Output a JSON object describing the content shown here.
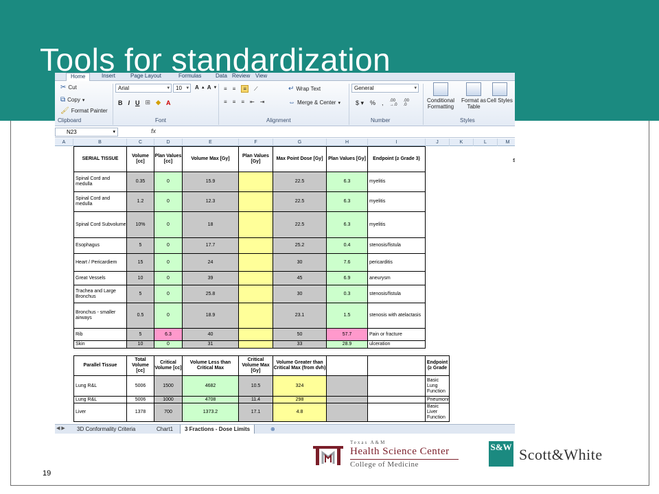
{
  "slide": {
    "title": "Tools for standardization",
    "page_number": "19",
    "accent_color": "#1b8a80"
  },
  "excel": {
    "ribbon_tabs": [
      "Home",
      "Insert",
      "Page Layout",
      "Formulas",
      "Data",
      "Review",
      "View"
    ],
    "clipboard": {
      "cut": "Cut",
      "copy": "Copy",
      "format_painter": "Format Painter",
      "label": "Clipboard"
    },
    "font": {
      "name": "Arial",
      "size": "10",
      "label": "Font"
    },
    "alignment": {
      "wrap_text": "Wrap Text",
      "merge_center": "Merge & Center",
      "label": "Alignment"
    },
    "number": {
      "format": "General",
      "label": "Number"
    },
    "styles": {
      "conditional": "Conditional Formatting",
      "format_table": "Format as Table",
      "cell_styles": "Cell Styles",
      "label": "Styles"
    },
    "name_box": "N23",
    "fx": "fx",
    "columns": [
      "A",
      "B",
      "C",
      "D",
      "E",
      "F",
      "G",
      "H",
      "I",
      "J",
      "K",
      "L",
      "M"
    ],
    "sheet_tabs": [
      "3D Conformality Criteria",
      "Chart1",
      "3 Fractions - Dose Limits"
    ],
    "serial_headers": [
      "SERIAL TISSUE",
      "Volume [cc]",
      "Plan Values [cc]",
      "Volume Max [Gy]",
      "Plan Values [Gy]",
      "Max Point Dose [Gy]",
      "Plan Values [Gy]",
      "Endpoint (≥ Grade 3)"
    ],
    "serial_rows": [
      [
        "Spinal Cord and medulla",
        "0.35",
        "0",
        "15.9",
        "",
        "22.5",
        "6.3",
        "myelitis"
      ],
      [
        "Spinal Cord and medulla",
        "1.2",
        "0",
        "12.3",
        "",
        "22.5",
        "6.3",
        "myelitis"
      ],
      [
        "Spinal Cord Subvolume",
        "10%",
        "0",
        "18",
        "",
        "22.5",
        "6.3",
        "myelitis"
      ],
      [
        "Esophagus",
        "5",
        "0",
        "17.7",
        "",
        "25.2",
        "0.4",
        "stenosis/fistula"
      ],
      [
        "Heart / Pericardiem",
        "15",
        "0",
        "24",
        "",
        "30",
        "7.6",
        "pericarditis"
      ],
      [
        "Great Vessels",
        "10",
        "0",
        "39",
        "",
        "45",
        "6.9",
        "aneurysm"
      ],
      [
        "Trachea and Large Bronchus",
        "5",
        "0",
        "25.8",
        "",
        "30",
        "0.3",
        "stenosis/fistula"
      ],
      [
        "Bronchus - smaller airways",
        "0.5",
        "0",
        "18.9",
        "",
        "23.1",
        "1.5",
        "stenosis with atelactasis"
      ],
      [
        "Rib",
        "5",
        "6.3",
        "40",
        "",
        "50",
        "57.7",
        "Pain or fracture"
      ],
      [
        "Skin",
        "10",
        "0",
        "31",
        "",
        "33",
        "28.9",
        "ulceration"
      ]
    ],
    "parallel_headers": [
      "Parallel Tissue",
      "Total Volume [cc]",
      "Critical Volume [cc]",
      "Volume Less than Critical Max",
      "Critical Volume Max [Gy]",
      "Volume Greater than Critical Max (from dvh)",
      "",
      "",
      "Endpoint (≥ Grade"
    ],
    "parallel_rows": [
      [
        "Lung R&L",
        "5006",
        "1500",
        "4682",
        "10.5",
        "324",
        "",
        "",
        "Basic Lung Function"
      ],
      [
        "Lung R&L",
        "5006",
        "1000",
        "4708",
        "11.4",
        "298",
        "",
        "",
        "Pneumonitis"
      ],
      [
        "Liver",
        "1378",
        "700",
        "1373.2",
        "17.1",
        "4.8",
        "",
        "",
        "Basic Liver Function"
      ]
    ],
    "partial_right_header": "S"
  },
  "logos": {
    "tamu_small": "Texas A&M",
    "tamu_main": "Health Science Center",
    "tamu_sub": "College of Medicine",
    "sw_text": "Scott&White",
    "sw_mark": "S&W"
  }
}
